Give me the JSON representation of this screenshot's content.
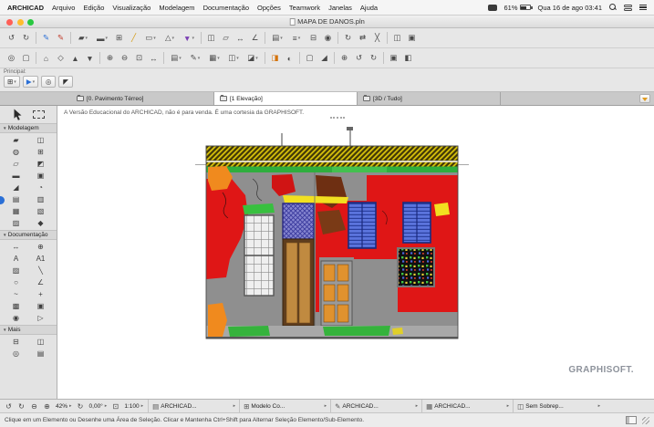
{
  "menubar": {
    "items": [
      {
        "name": "menu-archicad",
        "label": "ARCHICAD",
        "bold": true
      },
      {
        "name": "menu-arquivo",
        "label": "Arquivo"
      },
      {
        "name": "menu-edicao",
        "label": "Edição"
      },
      {
        "name": "menu-visualizacao",
        "label": "Visualização"
      },
      {
        "name": "menu-modelagem",
        "label": "Modelagem"
      },
      {
        "name": "menu-documentacao",
        "label": "Documentação"
      },
      {
        "name": "menu-opcoes",
        "label": "Opções"
      },
      {
        "name": "menu-teamwork",
        "label": "Teamwork"
      },
      {
        "name": "menu-janelas",
        "label": "Janelas"
      },
      {
        "name": "menu-ajuda",
        "label": "Ajuda"
      }
    ],
    "status": {
      "battery": "61%",
      "clock": "Qua 16 de ago 03:41"
    }
  },
  "window": {
    "title": "MAPA DE DANOS.pln"
  },
  "toolbar1": {
    "icons": [
      {
        "name": "undo-icon",
        "glyph": "↺"
      },
      {
        "name": "redo-icon",
        "glyph": "↻"
      },
      {
        "sep": true
      },
      {
        "name": "pen-tool-icon",
        "glyph": "✎",
        "tint": "#2a6fd6"
      },
      {
        "name": "marker-tool-icon",
        "glyph": "✎",
        "tint": "#c03a2a"
      },
      {
        "sep": true
      },
      {
        "name": "wall-tool-icon",
        "glyph": "▰",
        "caret": true
      },
      {
        "name": "slab-tool-icon",
        "glyph": "▬",
        "caret": true
      },
      {
        "name": "grid-snap-icon",
        "glyph": "⊞"
      },
      {
        "name": "guide-line-icon",
        "glyph": "╱",
        "tint": "#d49a10"
      },
      {
        "name": "geometry-rect-icon",
        "glyph": "▭",
        "caret": true
      },
      {
        "name": "geometry-poly-icon",
        "glyph": "△",
        "caret": true
      },
      {
        "name": "pen-color-icon",
        "glyph": "▼",
        "tint": "#7b3fb3",
        "caret": true
      },
      {
        "sep": true
      },
      {
        "name": "column-tool-icon",
        "glyph": "◫"
      },
      {
        "name": "beam-tool-icon",
        "glyph": "▱"
      },
      {
        "name": "dimension-tool-icon",
        "glyph": "↔"
      },
      {
        "name": "angle-dimension-icon",
        "glyph": "∠"
      },
      {
        "sep": true
      },
      {
        "name": "layer-settings-icon",
        "glyph": "▤",
        "caret": true
      },
      {
        "name": "story-settings-icon",
        "glyph": "≡",
        "caret": true
      },
      {
        "name": "section-tool-icon",
        "glyph": "⊟"
      },
      {
        "name": "camera-tool-icon",
        "glyph": "◉"
      },
      {
        "sep": true
      },
      {
        "name": "rotate-icon",
        "glyph": "↻"
      },
      {
        "name": "mirror-icon",
        "glyph": "⇄"
      },
      {
        "name": "split-icon",
        "glyph": "╳"
      },
      {
        "sep": true
      },
      {
        "name": "copy-icon",
        "glyph": "◫"
      },
      {
        "name": "clipboard-icon",
        "glyph": "▣"
      }
    ]
  },
  "toolbar2": {
    "icons": [
      {
        "name": "find-select-icon",
        "glyph": "◎"
      },
      {
        "name": "select-all-icon",
        "glyph": "▢"
      },
      {
        "sep": true
      },
      {
        "name": "floor-plan-icon",
        "glyph": "⌂"
      },
      {
        "name": "model-3d-icon",
        "glyph": "◇"
      },
      {
        "name": "story-up-icon",
        "glyph": "▲"
      },
      {
        "name": "story-down-icon",
        "glyph": "▼"
      },
      {
        "sep": true
      },
      {
        "name": "zoom-in-icon",
        "glyph": "⊕"
      },
      {
        "name": "zoom-out-icon",
        "glyph": "⊖"
      },
      {
        "name": "fit-window-icon",
        "glyph": "⊡"
      },
      {
        "name": "pan-icon",
        "glyph": "↔"
      },
      {
        "sep": true
      },
      {
        "name": "layers-dialog-icon",
        "glyph": "▤",
        "caret": true
      },
      {
        "name": "pen-sets-icon",
        "glyph": "✎",
        "caret": true
      },
      {
        "name": "model-view-options-icon",
        "glyph": "▦",
        "caret": true
      },
      {
        "name": "graphic-override-icon",
        "glyph": "◫",
        "caret": true
      },
      {
        "name": "renovation-filter-icon",
        "glyph": "◪",
        "caret": true
      },
      {
        "sep": true
      },
      {
        "name": "trace-reference-icon",
        "glyph": "◨",
        "tint": "#d4720a"
      },
      {
        "name": "virtual-trace-icon",
        "glyph": "◐"
      },
      {
        "sep": true
      },
      {
        "name": "marquee-view-icon",
        "glyph": "▢"
      },
      {
        "name": "cutting-plane-icon",
        "glyph": "◢"
      },
      {
        "sep": true
      },
      {
        "name": "zoom-selection-icon",
        "glyph": "⊕"
      },
      {
        "name": "previous-view-icon",
        "glyph": "↺"
      },
      {
        "name": "next-view-icon",
        "glyph": "↻"
      },
      {
        "sep": true
      },
      {
        "name": "publisher-icon",
        "glyph": "▣"
      },
      {
        "name": "organizer-icon",
        "glyph": "◧"
      }
    ]
  },
  "principal": {
    "label": "Principal:",
    "controls": [
      {
        "name": "favorites-button",
        "glyph": "⊞",
        "caret": true
      },
      {
        "name": "default-settings-button",
        "glyph": "▶",
        "tint": "#2a6fd6",
        "caret": true
      },
      {
        "name": "origin-button",
        "glyph": "◎"
      },
      {
        "name": "arrow-cursor-button",
        "glyph": "◤"
      }
    ]
  },
  "tabs": [
    {
      "name": "tab-pavimento-terreo",
      "label": "[0. Pavimento Térreo]"
    },
    {
      "name": "tab-elevacao",
      "label": "[1 Elevação]",
      "active": true
    },
    {
      "name": "tab-3d-tudo",
      "label": "[3D / Tudo]"
    }
  ],
  "sidebar": {
    "sections": {
      "modeling": "Modelagem",
      "documentation": "Documentação",
      "more": "Mais"
    },
    "modeling_tools": [
      {
        "name": "wall-tool",
        "glyph": "▰"
      },
      {
        "name": "door-tool",
        "glyph": "◫"
      },
      {
        "name": "column-tool",
        "glyph": "◍"
      },
      {
        "name": "window-tool",
        "glyph": "⊞"
      },
      {
        "name": "beam-tool",
        "glyph": "▱"
      },
      {
        "name": "skylight-tool",
        "glyph": "◩"
      },
      {
        "name": "slab-tool",
        "glyph": "▬"
      },
      {
        "name": "object-tool",
        "glyph": "▣"
      },
      {
        "name": "roof-tool",
        "glyph": "◢"
      },
      {
        "name": "shell-tool",
        "glyph": "◔"
      },
      {
        "name": "stair-tool",
        "glyph": "▤"
      },
      {
        "name": "railing-tool",
        "glyph": "▥"
      },
      {
        "name": "mesh-tool",
        "glyph": "▦"
      },
      {
        "name": "zone-tool",
        "glyph": "▧"
      },
      {
        "name": "curtain-wall-tool",
        "glyph": "▨"
      },
      {
        "name": "morph-tool",
        "glyph": "◆"
      }
    ],
    "documentation_tools": [
      {
        "name": "dimension-tool",
        "glyph": "↔"
      },
      {
        "name": "level-dimension-tool",
        "glyph": "⊕"
      },
      {
        "name": "text-tool",
        "glyph": "A"
      },
      {
        "name": "label-tool",
        "glyph": "A1"
      },
      {
        "name": "fill-tool",
        "glyph": "▨"
      },
      {
        "name": "line-tool",
        "glyph": "╲"
      },
      {
        "name": "arc-tool",
        "glyph": "○"
      },
      {
        "name": "polyline-tool",
        "glyph": "∠"
      },
      {
        "name": "spline-tool",
        "glyph": "~"
      },
      {
        "name": "hotspot-tool",
        "glyph": "+"
      },
      {
        "name": "figure-tool",
        "glyph": "▩"
      },
      {
        "name": "drawing-tool",
        "glyph": "▣"
      },
      {
        "name": "camera-tool",
        "glyph": "◉"
      },
      {
        "name": "marker-tool",
        "glyph": "▷"
      }
    ],
    "more_tools": [
      {
        "name": "section-tool",
        "glyph": "⊟"
      },
      {
        "name": "elevation-tool",
        "glyph": "◫"
      },
      {
        "name": "interior-elevation-tool",
        "glyph": "◎"
      },
      {
        "name": "worksheet-tool",
        "glyph": "▤"
      }
    ]
  },
  "canvas": {
    "edu_notice": "A Versão Educacional do ARCHICAD, não é para venda. É uma cortesia da GRAPHISOFT.",
    "watermark": "GRAPHISOFT."
  },
  "statusbar": {
    "nav_icons": [
      {
        "name": "zoom-back-icon",
        "glyph": "↺"
      },
      {
        "name": "zoom-forward-icon",
        "glyph": "↻"
      },
      {
        "name": "zoom-out-icon",
        "glyph": "⊖"
      },
      {
        "name": "zoom-in-icon",
        "glyph": "⊕"
      }
    ],
    "zoom": "42%",
    "orientation_glyph": "↻",
    "rotation": "0,00°",
    "fit_glyph": "⊡",
    "scale": "1:100",
    "panes": [
      {
        "name": "layer-combination-pane",
        "glyph": "▤",
        "label": "ARCHICAD..."
      },
      {
        "name": "structure-display-pane",
        "glyph": "⊞",
        "label": "Modelo Co..."
      },
      {
        "name": "pen-set-pane",
        "glyph": "✎",
        "label": "ARCHICAD..."
      },
      {
        "name": "model-view-pane",
        "glyph": "▦",
        "label": "ARCHICAD..."
      },
      {
        "name": "graphic-override-pane",
        "glyph": "◫",
        "label": "Sem Sobrep..."
      }
    ]
  },
  "helpbar": {
    "text": "Clique em um Elemento ou Desenhe uma Área de Seleção. Clicar e Mantenha Ctrl+Shift para Alternar Seleção Elemento/Sub-Elemento."
  },
  "colors": {
    "damage_red": "#df1616",
    "facade_gray": "#8f8f8f",
    "roof_hatch_yellow": "#d8c20a",
    "band_green": "#2fae3e",
    "shutter_blue": "#5b74dd",
    "door_tan": "#c08a40",
    "damage_orange": "#f08a1e",
    "damage_brown": "#6e2f12",
    "highlight_yellow": "#f2e020"
  }
}
